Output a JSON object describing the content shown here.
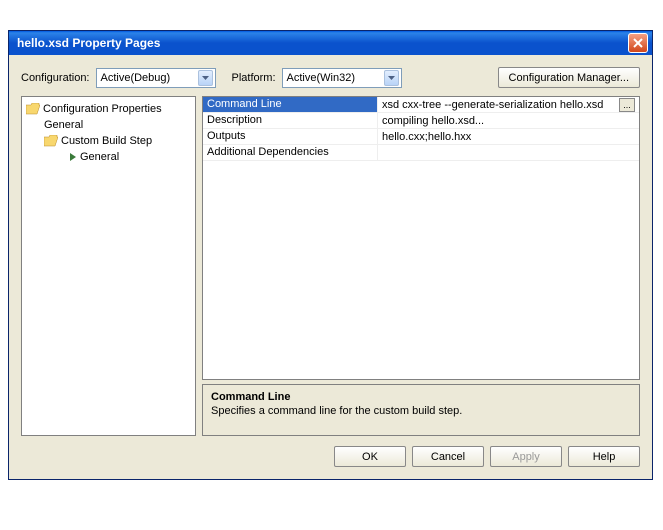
{
  "title": "hello.xsd Property Pages",
  "config": {
    "label": "Configuration:",
    "value": "Active(Debug)",
    "platformLabel": "Platform:",
    "platformValue": "Active(Win32)",
    "managerBtn": "Configuration Manager..."
  },
  "tree": {
    "root": "Configuration Properties",
    "n1": "General",
    "n2": "Custom Build Step",
    "n3": "General"
  },
  "props": {
    "r0": {
      "name": "Command Line",
      "value": "xsd cxx-tree --generate-serialization hello.xsd"
    },
    "r1": {
      "name": "Description",
      "value": "compiling hello.xsd..."
    },
    "r2": {
      "name": "Outputs",
      "value": "hello.cxx;hello.hxx"
    },
    "r3": {
      "name": "Additional Dependencies",
      "value": ""
    }
  },
  "desc": {
    "title": "Command Line",
    "text": "Specifies a command line for the custom build step."
  },
  "buttons": {
    "ok": "OK",
    "cancel": "Cancel",
    "apply": "Apply",
    "help": "Help"
  },
  "ellipsis": "..."
}
